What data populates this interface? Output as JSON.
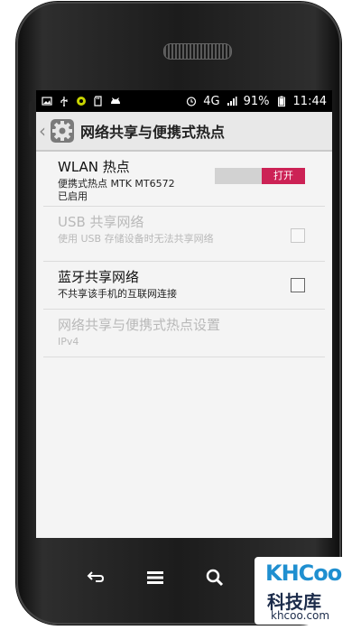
{
  "status": {
    "network": "4G",
    "battery": "91%",
    "time": "11:44"
  },
  "actionbar": {
    "title": "网络共享与便携式热点"
  },
  "items": [
    {
      "title": "WLAN 热点",
      "summary": "便携式热点 MTK MT6572 已启用",
      "toggle_label": "打开"
    },
    {
      "title": "USB 共享网络",
      "summary": "使用 USB 存储设备时无法共享网络",
      "enabled": false
    },
    {
      "title": "蓝牙共享网络",
      "summary": "不共享该手机的互联网连接",
      "checked": false
    },
    {
      "title": "网络共享与便携式热点设置",
      "summary": "IPv4",
      "enabled": false
    }
  ],
  "watermark": {
    "logo": "KHCoo",
    "name": "科技库",
    "url": "khcoo.com"
  },
  "colors": {
    "accent": "#cc2255",
    "statusbar": "#000000",
    "screen_bg": "#f4f4f4",
    "watermark_blue": "#1f8fd0"
  },
  "icons": [
    "image-icon",
    "usb-icon",
    "android-icon",
    "sd-card-icon",
    "cat-icon",
    "alarm-icon",
    "signal-icon",
    "battery-icon",
    "gear-icon",
    "back-icon",
    "home-icon",
    "search-icon"
  ]
}
